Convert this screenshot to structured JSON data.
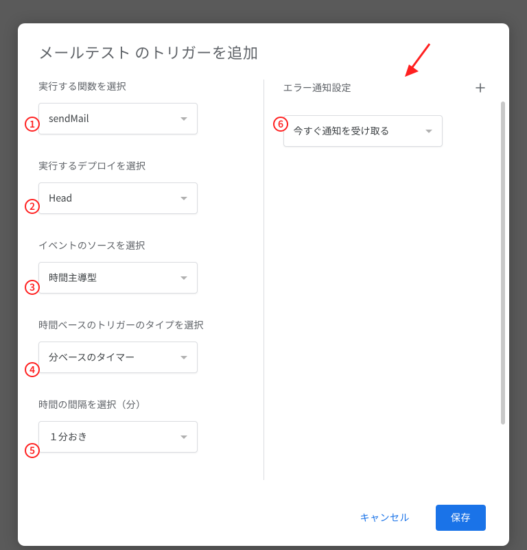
{
  "title": "メールテスト のトリガーを追加",
  "leftColumn": {
    "functionLabel": "実行する関数を選択",
    "functionValue": "sendMail",
    "deployLabel": "実行するデプロイを選択",
    "deployValue": "Head",
    "sourceLabel": "イベントのソースを選択",
    "sourceValue": "時間主導型",
    "typeLabel": "時間ベースのトリガーのタイプを選択",
    "typeValue": "分ベースのタイマー",
    "intervalLabel": "時間の間隔を選択（分）",
    "intervalValue": "１分おき"
  },
  "rightColumn": {
    "notifyLabel": "エラー通知設定",
    "notifyValue": "今すぐ通知を受け取る"
  },
  "footer": {
    "cancel": "キャンセル",
    "save": "保存"
  },
  "markers": {
    "m1": "1",
    "m2": "2",
    "m3": "3",
    "m4": "4",
    "m5": "5",
    "m6": "6"
  }
}
